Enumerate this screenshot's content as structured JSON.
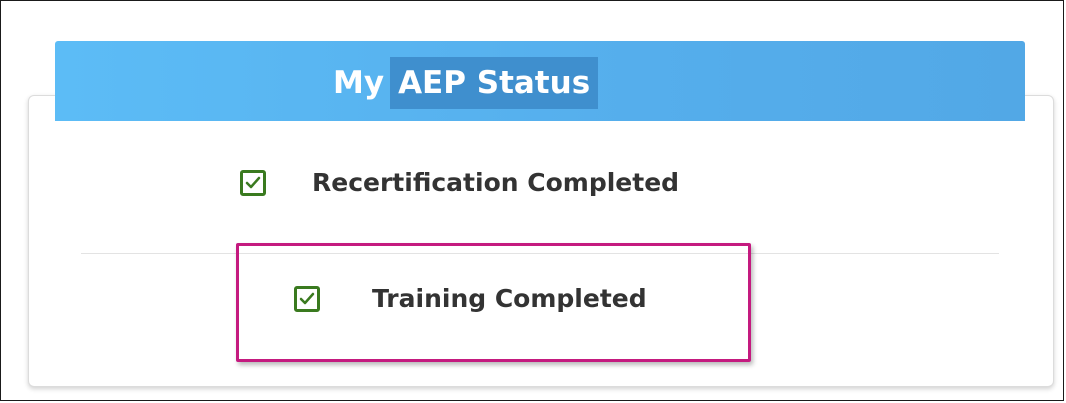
{
  "panel": {
    "title_prefix": "My",
    "title_main": "AEP Status",
    "items": [
      {
        "label": "Recertification Completed",
        "checked": true,
        "icon": "checkbox-checked-icon"
      },
      {
        "label": "Training Completed",
        "checked": true,
        "icon": "checkbox-checked-icon",
        "highlighted": true
      }
    ]
  },
  "colors": {
    "header_blue": "#55aeec",
    "title_highlight": "#3f8fce",
    "check_green": "#3a7a1f",
    "annotation_magenta": "#c41a7f",
    "text": "#333333"
  }
}
